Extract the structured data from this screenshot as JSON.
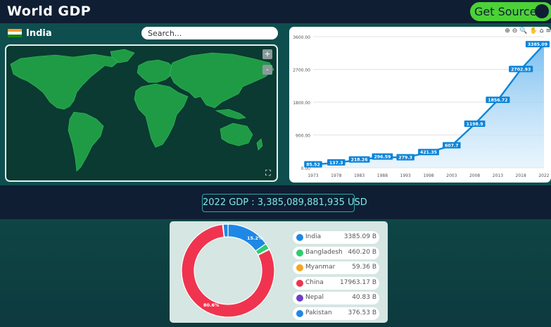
{
  "header": {
    "title": "World GDP",
    "source_button": "Get Source"
  },
  "selection": {
    "country": "India",
    "search_placeholder": "Search..."
  },
  "map": {
    "zoom_in": "+",
    "zoom_out": "-"
  },
  "summary": {
    "gdp_text": "2022 GDP : 3,385,089,881,935 USD"
  },
  "chart_data": [
    {
      "type": "area",
      "x": [
        "1973",
        "1978",
        "1983",
        "1988",
        "1993",
        "1998",
        "2003",
        "2008",
        "2013",
        "2018",
        "2022"
      ],
      "values": [
        85.52,
        137.3,
        218.26,
        296.59,
        279.3,
        421.35,
        607.7,
        1198.9,
        1856.72,
        2702.93,
        3385.09
      ],
      "y_ticks": [
        "0.00",
        "900.00",
        "1800.00",
        "2700.00",
        "3600.00"
      ],
      "ylim": [
        0,
        3600
      ],
      "color": "#0b84d8",
      "grid": true
    },
    {
      "type": "pie",
      "donut": true,
      "labels": [
        "India",
        "Bangladesh",
        "Myanmar",
        "China",
        "Nepal",
        "Pakistan"
      ],
      "values": [
        3385.09,
        460.2,
        59.36,
        17963.17,
        40.83,
        376.53
      ],
      "display_values": [
        "3385.09 B",
        "460.20 B",
        "59.36 B",
        "17963.17 B",
        "40.83 B",
        "376.53 B"
      ],
      "colors": [
        "#1e88e5",
        "#2ecc71",
        "#f5a623",
        "#f0344f",
        "#6c3fc7",
        "#1e88e5"
      ],
      "data_labels": [
        "15.2%",
        "80.6%"
      ]
    }
  ]
}
